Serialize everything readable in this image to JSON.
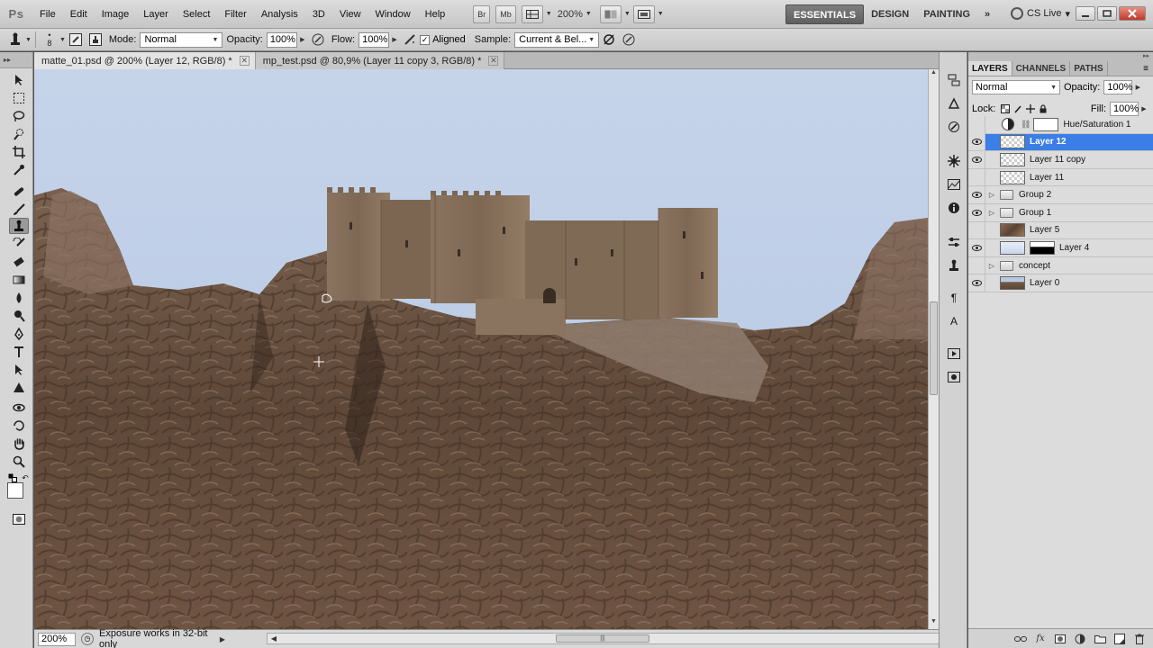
{
  "menubar": {
    "logo": "Ps",
    "items": [
      "File",
      "Edit",
      "Image",
      "Layer",
      "Select",
      "Filter",
      "Analysis",
      "3D",
      "View",
      "Window",
      "Help"
    ],
    "bridge_label": "Br",
    "minibridge_label": "Mb",
    "zoom": "200%",
    "workspaces": [
      "ESSENTIALS",
      "DESIGN",
      "PAINTING"
    ],
    "more_workspaces": "»",
    "cs_live": "CS Live",
    "cs_live_caret": "▾"
  },
  "options": {
    "brush_size": "8",
    "mode_label": "Mode:",
    "mode_value": "Normal",
    "opacity_label": "Opacity:",
    "opacity_value": "100%",
    "flow_label": "Flow:",
    "flow_value": "100%",
    "aligned_label": "Aligned",
    "aligned_checked": "✓",
    "sample_label": "Sample:",
    "sample_value": "Current & Bel..."
  },
  "tabs": [
    {
      "label": "matte_01.psd @ 200% (Layer 12, RGB/8) *",
      "close": "✕"
    },
    {
      "label": "mp_test.psd @ 80,9% (Layer 11 copy 3, RGB/8) *",
      "close": "✕"
    }
  ],
  "status": {
    "zoom": "200%",
    "message": "Exposure works in 32-bit only",
    "arrow_right": "▶",
    "arrow_left": "◀",
    "thumb_grip": "|||"
  },
  "layers_panel": {
    "tabs": [
      "LAYERS",
      "CHANNELS",
      "PATHS"
    ],
    "menu": "≡",
    "blend_mode": "Normal",
    "opacity_label": "Opacity:",
    "opacity_value": "100%",
    "lock_label": "Lock:",
    "fill_label": "Fill:",
    "fill_value": "100%",
    "layers": [
      {
        "name": "Hue/Saturation 1",
        "visible": false,
        "kind": "adjustment"
      },
      {
        "name": "Layer 12",
        "visible": true,
        "kind": "pixel",
        "selected": true
      },
      {
        "name": "Layer 11 copy",
        "visible": true,
        "kind": "pixel"
      },
      {
        "name": "Layer 11",
        "visible": false,
        "kind": "pixel"
      },
      {
        "name": "Group 2",
        "visible": true,
        "kind": "group"
      },
      {
        "name": "Group 1",
        "visible": true,
        "kind": "group"
      },
      {
        "name": "Layer 5",
        "visible": false,
        "kind": "image"
      },
      {
        "name": "Layer 4",
        "visible": true,
        "kind": "masked"
      },
      {
        "name": "concept",
        "visible": false,
        "kind": "group"
      },
      {
        "name": "Layer 0",
        "visible": true,
        "kind": "photo"
      }
    ]
  },
  "colors": {
    "selection": "#3a7ee6",
    "sky": "#c3d1e8",
    "rock": "#6a5040",
    "castle": "#8a735d"
  }
}
